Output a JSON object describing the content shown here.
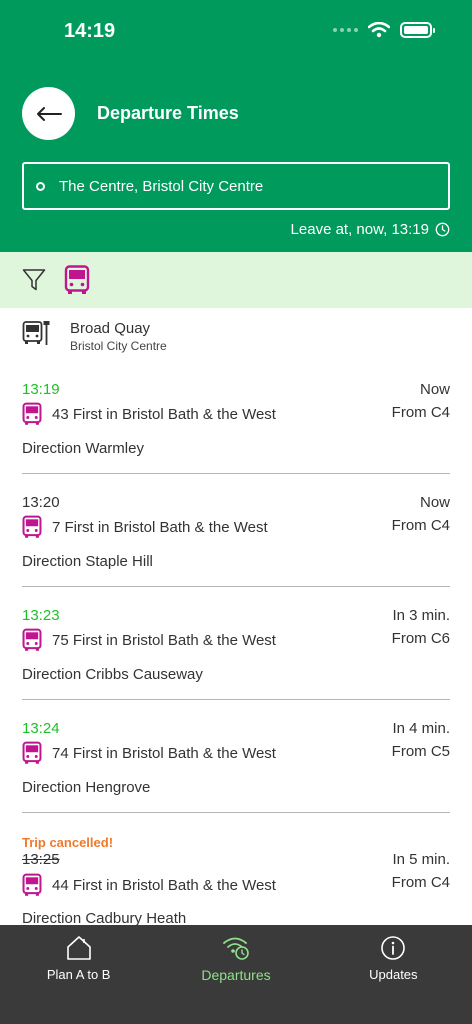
{
  "status": {
    "time": "14:19"
  },
  "header": {
    "title": "Departure Times",
    "search_value": "The Centre, Bristol City Centre",
    "leave_at": "Leave at, now, 13:19"
  },
  "stop": {
    "name": "Broad Quay",
    "area": "Bristol City Centre"
  },
  "departures": [
    {
      "time": "13:19",
      "state": "live",
      "route": "43 First in Bristol Bath & the West",
      "direction": "Direction Warmley",
      "when": "Now",
      "stand": "From C4"
    },
    {
      "time": "13:20",
      "state": "planned",
      "route": "7 First in Bristol Bath & the West",
      "direction": "Direction Staple Hill",
      "when": "Now",
      "stand": "From C4"
    },
    {
      "time": "13:23",
      "state": "live",
      "route": "75 First in Bristol Bath & the West",
      "direction": "Direction Cribbs Causeway",
      "when": "In 3 min.",
      "stand": "From C6"
    },
    {
      "time": "13:24",
      "state": "live",
      "route": "74 First in Bristol Bath & the West",
      "direction": "Direction Hengrove",
      "when": "In 4 min.",
      "stand": "From C5"
    },
    {
      "time": "13:25",
      "state": "cancelled",
      "notice": "Trip cancelled!",
      "route": "44 First in Bristol Bath & the West",
      "direction": "Direction Cadbury Heath",
      "when": "In 5 min.",
      "stand": "From C4"
    }
  ],
  "tabs": [
    {
      "label": "Plan A to B",
      "icon": "home-icon"
    },
    {
      "label": "Departures",
      "icon": "departures-icon"
    },
    {
      "label": "Updates",
      "icon": "info-icon"
    }
  ],
  "colors": {
    "brand_green": "#009a5c",
    "filter_bg": "#dff5dc",
    "bus_magenta": "#c0158f",
    "live_time": "#1fbf2a",
    "cancel_orange": "#f07a2c",
    "tabbar_bg": "#3a3a3a",
    "tab_active": "#8fe08a"
  }
}
